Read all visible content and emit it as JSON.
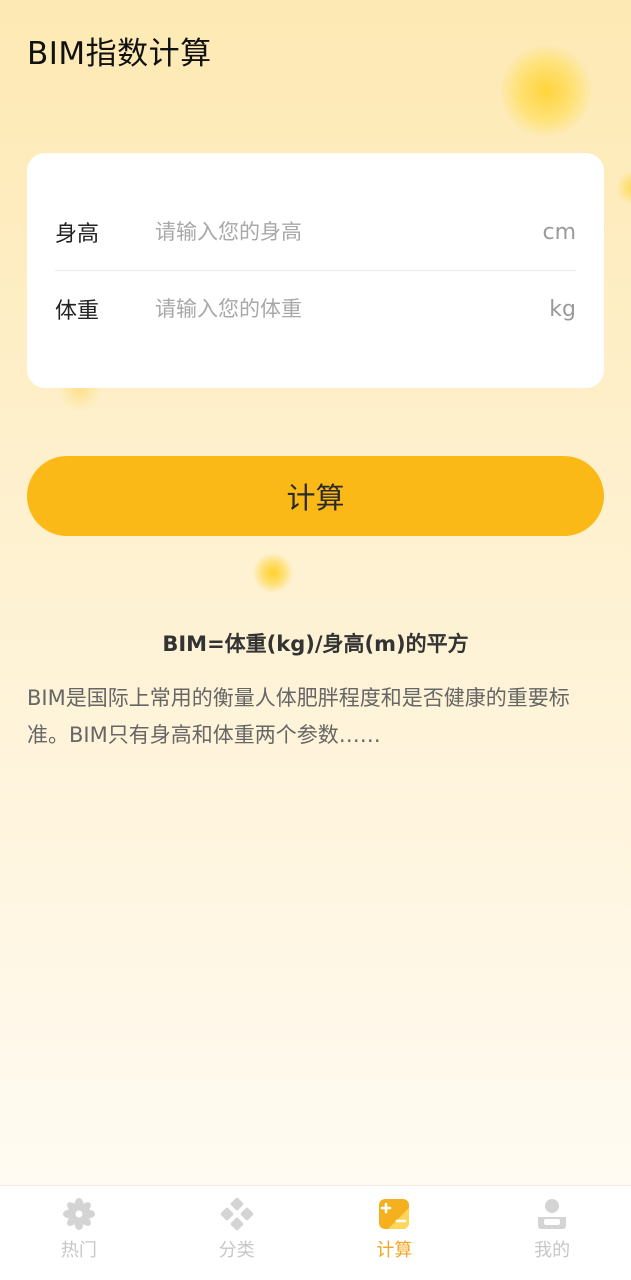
{
  "header": {
    "title": "BIM指数计算"
  },
  "form": {
    "height": {
      "label": "身高",
      "placeholder": "请输入您的身高",
      "unit": "cm"
    },
    "weight": {
      "label": "体重",
      "placeholder": "请输入您的体重",
      "unit": "kg"
    }
  },
  "calculate_button": {
    "label": "计算"
  },
  "info": {
    "formula": "BIM=体重(kg)/身高(m)的平方",
    "description": "BIM是国际上常用的衡量人体肥胖程度和是否健康的重要标准。BIM只有身高和体重两个参数……"
  },
  "tabbar": {
    "active": "calc",
    "items": [
      {
        "id": "hot",
        "label": "热门",
        "icon": "flower-icon"
      },
      {
        "id": "category",
        "label": "分类",
        "icon": "diamond-grid-icon"
      },
      {
        "id": "calc",
        "label": "计算",
        "icon": "calculator-icon"
      },
      {
        "id": "mine",
        "label": "我的",
        "icon": "user-icon"
      }
    ]
  },
  "colors": {
    "accent": "#fbb917",
    "tab_active": "#f5a623",
    "tab_inactive": "#c7c7c7"
  }
}
